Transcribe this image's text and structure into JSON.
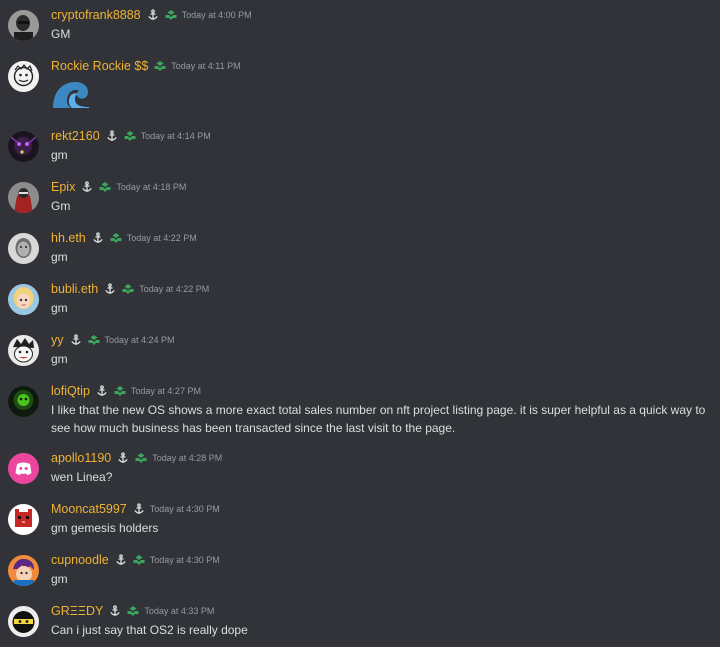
{
  "theme": {
    "background": "#313338",
    "username_color": "#f0b232",
    "text_color": "#dbdee1",
    "time_color": "#949ba4",
    "badge_color": "#3ba55c"
  },
  "messages": [
    {
      "username": "cryptofrank8888",
      "time": "Today at 4:00 PM",
      "text": "GM",
      "avatar": "dark-portrait",
      "badges": [
        "anchor-icon",
        "hands-icon"
      ]
    },
    {
      "username": "Rockie Rockie $$",
      "time": "Today at 4:11 PM",
      "text": "",
      "emoji": "wave-emoji",
      "avatar": "sketch-face",
      "badges": [
        "hands-icon"
      ]
    },
    {
      "username": "rekt2160",
      "time": "Today at 4:14 PM",
      "text": "gm",
      "avatar": "purple-creature",
      "badges": [
        "anchor-icon",
        "hands-icon"
      ]
    },
    {
      "username": "Epix",
      "time": "Today at 4:18 PM",
      "text": "Gm",
      "avatar": "red-armor",
      "badges": [
        "anchor-icon",
        "hands-icon"
      ]
    },
    {
      "username": "hh.eth",
      "time": "Today at 4:22 PM",
      "text": "gm",
      "avatar": "bw-portrait",
      "badges": [
        "anchor-icon",
        "hands-icon"
      ]
    },
    {
      "username": "bubli.eth",
      "time": "Today at 4:22 PM",
      "text": "gm",
      "avatar": "blonde-girl",
      "badges": [
        "anchor-icon",
        "hands-icon"
      ]
    },
    {
      "username": "yy",
      "time": "Today at 4:24 PM",
      "text": "gm",
      "avatar": "cartoon-face",
      "badges": [
        "anchor-icon",
        "hands-icon"
      ]
    },
    {
      "username": "lofiQtip",
      "time": "Today at 4:27 PM",
      "text": "I like that the new OS shows a more exact total sales number on nft project listing page.  it is super helpful as a quick way to see how much business has been transacted since the last visit to the page.",
      "avatar": "green-glow",
      "badges": [
        "anchor-icon",
        "hands-icon"
      ]
    },
    {
      "username": "apollo1190",
      "time": "Today at 4:28 PM",
      "text": "wen Linea?",
      "avatar": "discord-default-pink",
      "badges": [
        "anchor-icon",
        "hands-icon"
      ]
    },
    {
      "username": "Mooncat5997",
      "time": "Today at 4:30 PM",
      "text": "gm gemesis holders",
      "avatar": "red-pixel-cat",
      "badges": [
        "anchor-icon"
      ]
    },
    {
      "username": "cupnoodle",
      "time": "Today at 4:30 PM",
      "text": "gm",
      "avatar": "purple-hair",
      "badges": [
        "anchor-icon",
        "hands-icon"
      ]
    },
    {
      "username": "GRΞΞDY",
      "time": "Today at 4:33 PM",
      "text": "Can i just say that OS2 is really dope",
      "avatar": "ninja-yellow",
      "badges": [
        "anchor-icon",
        "hands-icon"
      ]
    }
  ]
}
